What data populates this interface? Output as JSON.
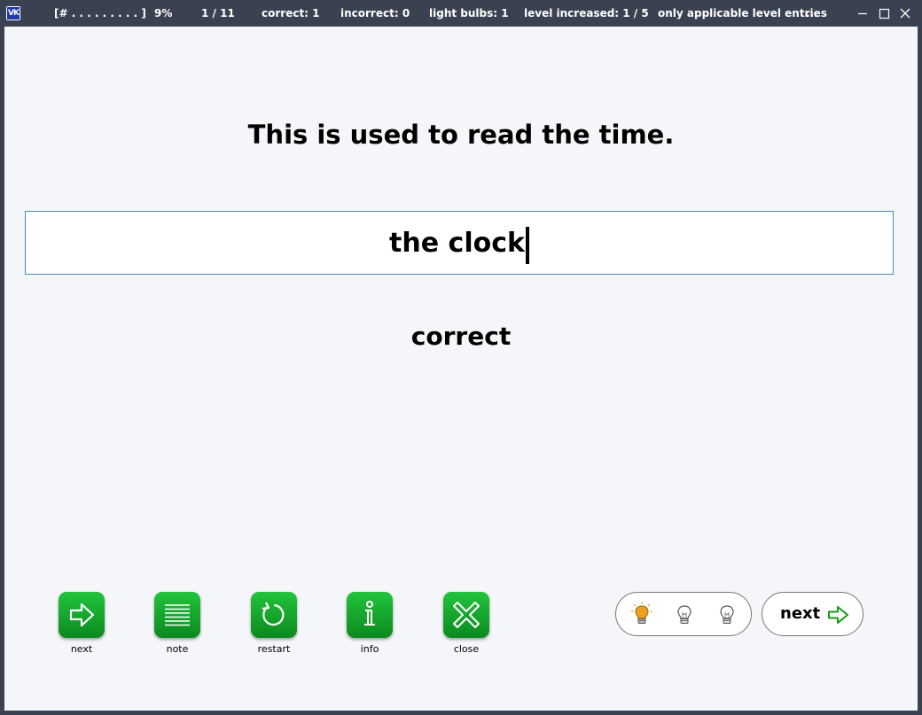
{
  "titlebar": {
    "logo_text": "VK",
    "progress_bar": "[# . . . . . . . . . ]",
    "percent": "9%",
    "position": "1 / 11",
    "correct": "correct: 1",
    "incorrect": "incorrect: 0",
    "light_bulbs": "light bulbs: 1",
    "level_increased": "level increased: 1 / 5",
    "mode": "only applicable level entries",
    "overflow": "..."
  },
  "card": {
    "question": "This is used to read the time.",
    "answer": "the clock",
    "result": "correct"
  },
  "toolbar": {
    "next_label": "next",
    "note_label": "note",
    "restart_label": "restart",
    "info_label": "info",
    "close_label": "close"
  },
  "hints": {
    "used": 1,
    "total": 3
  },
  "next_button": {
    "label": "next"
  },
  "colors": {
    "frame": "#3a4252",
    "content_bg": "#f5f6f9",
    "button_green": "#16a82e",
    "input_border": "#4a8ab8",
    "bulb_active": "#f0a020",
    "next_arrow": "#1a9a1a"
  },
  "icons": {
    "next": "arrow-right-icon",
    "note": "lines-icon",
    "restart": "restart-icon",
    "info": "info-icon",
    "close": "close-x-icon",
    "bulb": "light-bulb-icon"
  }
}
